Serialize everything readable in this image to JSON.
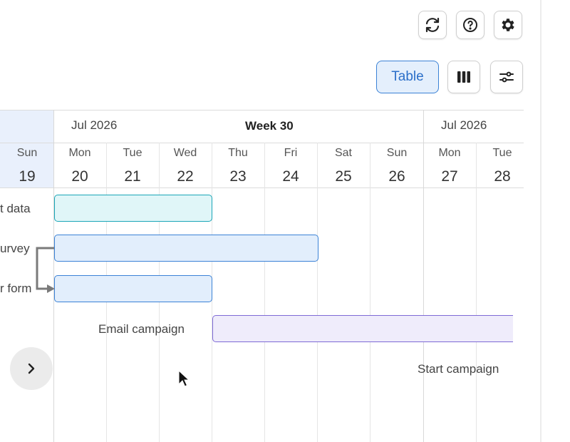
{
  "toolbar": {
    "sync_icon": "sync-icon",
    "help_icon": "help-icon",
    "settings_icon": "gear-icon"
  },
  "views": {
    "table_label": "Table",
    "columns_icon": "columns-icon",
    "filter_icon": "sliders-icon"
  },
  "timeline": {
    "months": [
      "Jul 2026",
      "Jul 2026"
    ],
    "week_label": "Week 30",
    "days": [
      {
        "name": "Sun",
        "num": "19"
      },
      {
        "name": "Mon",
        "num": "20"
      },
      {
        "name": "Tue",
        "num": "21"
      },
      {
        "name": "Wed",
        "num": "22"
      },
      {
        "name": "Thu",
        "num": "23"
      },
      {
        "name": "Fri",
        "num": "24"
      },
      {
        "name": "Sat",
        "num": "25"
      },
      {
        "name": "Sun",
        "num": "26"
      },
      {
        "name": "Mon",
        "num": "27"
      },
      {
        "name": "Tue",
        "num": "28"
      }
    ]
  },
  "tasks": [
    {
      "label": "t data"
    },
    {
      "label": "urvey"
    },
    {
      "label": "r form"
    },
    {
      "label": "Email campaign"
    },
    {
      "label": "Start campaign"
    }
  ],
  "colors": {
    "accent": "#3b82d6",
    "teal_bar": "#1aa6b7",
    "blue_bar": "#3b82d6",
    "purple_bar": "#7e6ad6"
  }
}
